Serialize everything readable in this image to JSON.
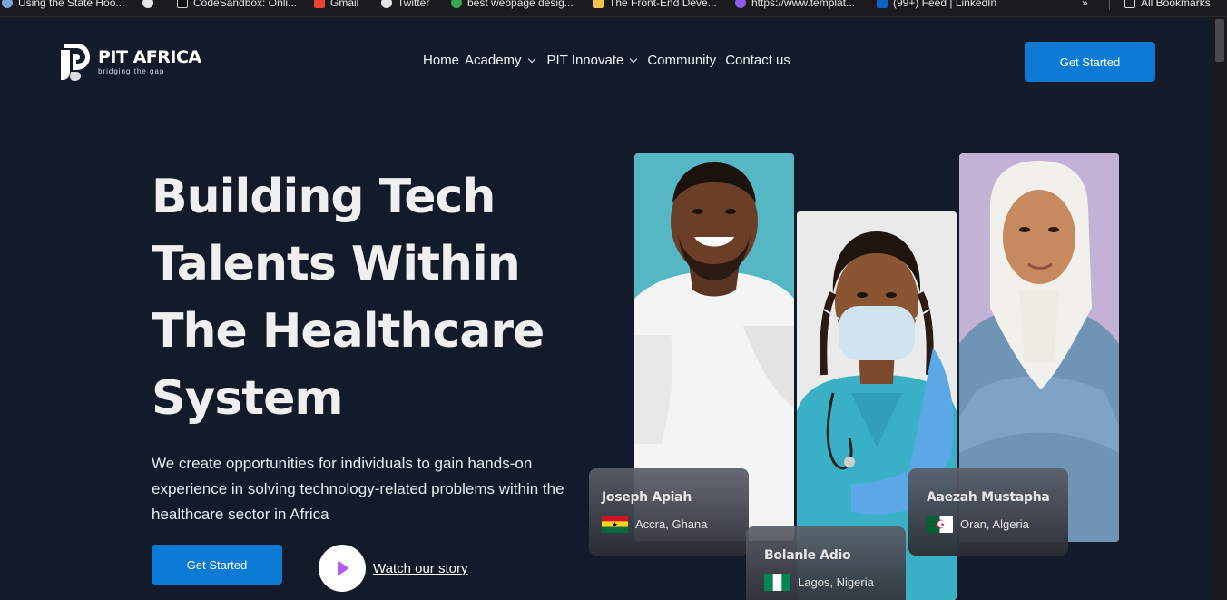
{
  "bookmarks": [
    {
      "label": "Using the State Hoo..."
    },
    {
      "label": ""
    },
    {
      "label": "CodeSandbox: Onli..."
    },
    {
      "label": "Gmail"
    },
    {
      "label": "Twitter"
    },
    {
      "label": "best webpage desig..."
    },
    {
      "label": "The Front-End Deve..."
    },
    {
      "label": "https://www.templat..."
    },
    {
      "label": "(99+) Feed | LinkedIn"
    }
  ],
  "bookmarks_overflow": "»",
  "all_bookmarks": "All Bookmarks",
  "brand": {
    "name": "PIT AFRICA",
    "tagline": "bridging the gap"
  },
  "nav": {
    "items": [
      {
        "label": "Home",
        "has_dropdown": false
      },
      {
        "label": "Academy",
        "has_dropdown": true
      },
      {
        "label": "PIT Innovate",
        "has_dropdown": true
      },
      {
        "label": "Community",
        "has_dropdown": false
      },
      {
        "label": "Contact us",
        "has_dropdown": false
      }
    ],
    "cta_label": "Get Started"
  },
  "hero": {
    "title_lines": [
      "Building Tech",
      "Talents Within",
      "The Healthcare",
      "System"
    ],
    "description": "We create opportunities for individuals to gain hands-on experience in solving technology-related problems within the healthcare sector in Africa",
    "cta_label": "Get Started",
    "watch_label": "Watch our story"
  },
  "people": [
    {
      "name": "Joseph Apiah",
      "location": "Accra, Ghana",
      "flag": "ghana-flag"
    },
    {
      "name": "Bolanle Adio",
      "location": "Lagos, Nigeria",
      "flag": "nigeria-flag"
    },
    {
      "name": "Aaezah Mustapha",
      "location": "Oran, Algeria",
      "flag": "algeria-flag"
    }
  ],
  "colors": {
    "background": "#131b2b",
    "accent": "#0a7ad4",
    "play_icon": "#b15bf0"
  }
}
